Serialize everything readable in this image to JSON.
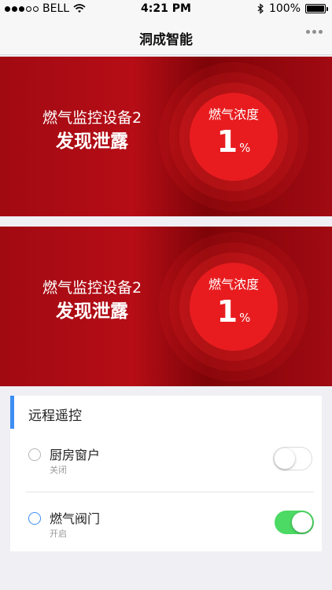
{
  "status_bar": {
    "carrier": "BELL",
    "time": "4:21 PM",
    "battery": "100%"
  },
  "nav": {
    "title": "洞成智能"
  },
  "alerts": [
    {
      "device": "燃气监控设备2",
      "status": "发现泄露",
      "gauge_label": "燃气浓度",
      "value": "1",
      "unit": "%"
    },
    {
      "device": "燃气监控设备2",
      "status": "发现泄露",
      "gauge_label": "燃气浓度",
      "value": "1",
      "unit": "%"
    }
  ],
  "remote_control": {
    "title": "远程遥控",
    "items": [
      {
        "name": "厨房窗户",
        "state": "关闭",
        "on": false
      },
      {
        "name": "燃气阀门",
        "state": "开启",
        "on": true
      }
    ]
  },
  "icons": [
    "signal-dots-icon",
    "wifi-icon",
    "bluetooth-icon",
    "battery-icon",
    "more-icon",
    "radio-icon"
  ],
  "colors": {
    "alert_red": "#b60d16",
    "gauge_red": "#e81c1f",
    "accent_blue": "#3c8ef3",
    "toggle_green": "#4cd964"
  }
}
